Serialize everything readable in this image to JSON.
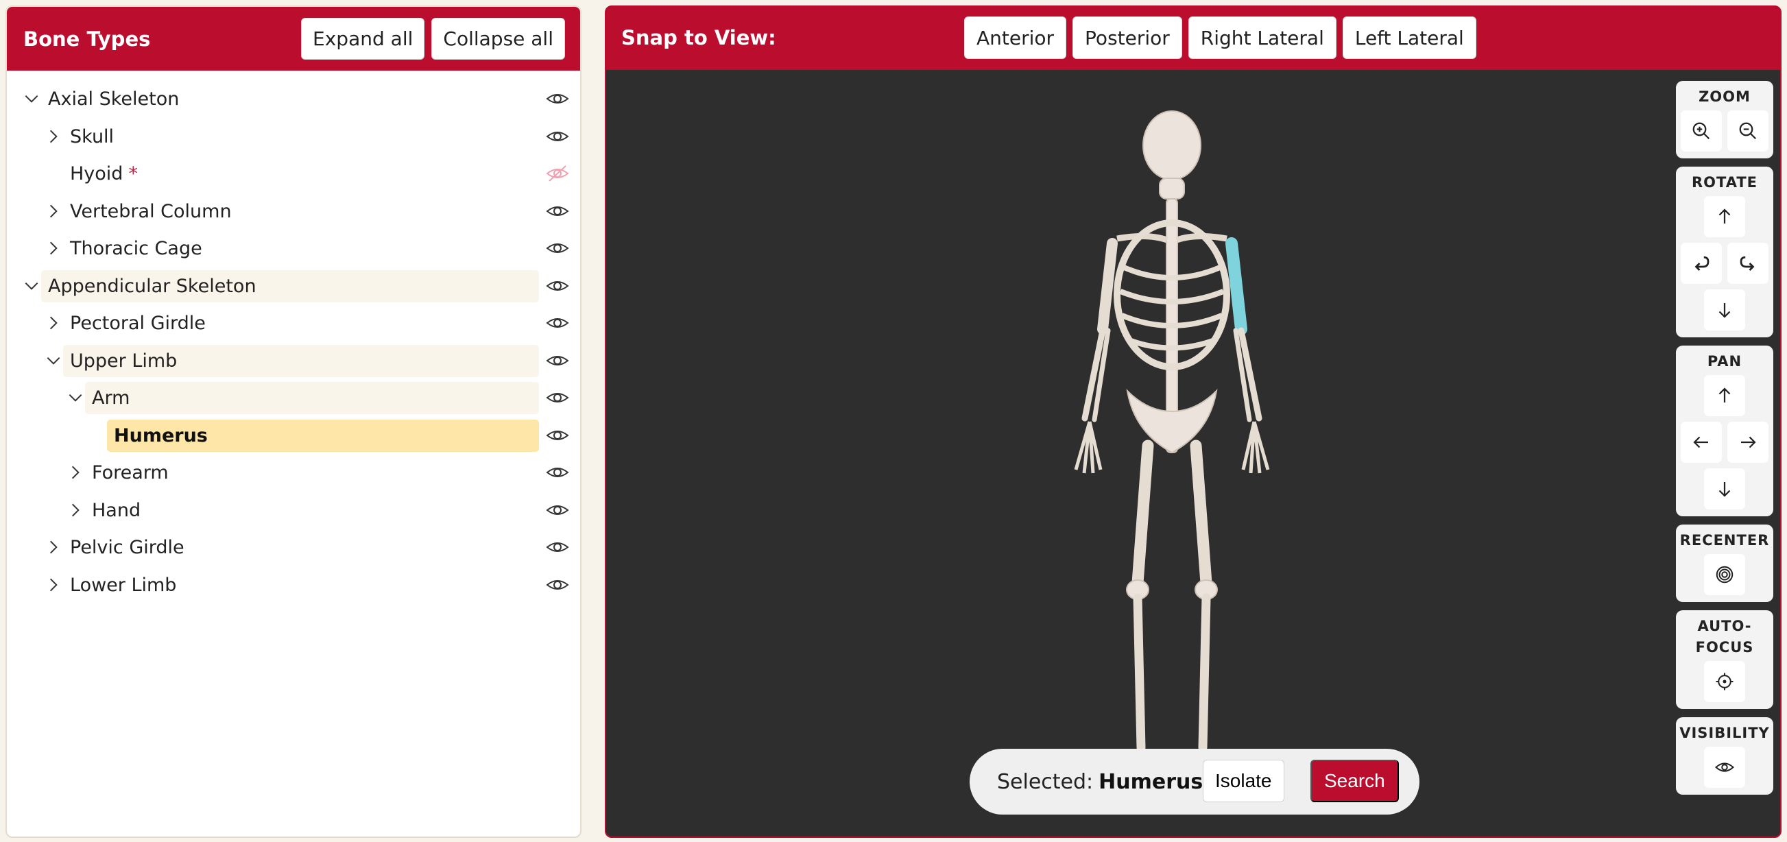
{
  "left_panel": {
    "title": "Bone Types",
    "expand_all": "Expand all",
    "collapse_all": "Collapse all",
    "tree": [
      {
        "label": "Axial Skeleton",
        "level": 0,
        "chevron": "down",
        "visible": true
      },
      {
        "label": "Skull",
        "level": 1,
        "chevron": "right",
        "visible": true
      },
      {
        "label": "Hyoid",
        "level": 1,
        "chevron": "none",
        "visible": false,
        "marker": "*"
      },
      {
        "label": "Vertebral Column",
        "level": 1,
        "chevron": "right",
        "visible": true
      },
      {
        "label": "Thoracic Cage",
        "level": 1,
        "chevron": "right",
        "visible": true
      },
      {
        "label": "Appendicular Skeleton",
        "level": 0,
        "chevron": "down",
        "visible": true,
        "highlight": "soft"
      },
      {
        "label": "Pectoral Girdle",
        "level": 1,
        "chevron": "right",
        "visible": true
      },
      {
        "label": "Upper Limb",
        "level": 1,
        "chevron": "down",
        "visible": true,
        "highlight": "soft"
      },
      {
        "label": "Arm",
        "level": 2,
        "chevron": "down",
        "visible": true,
        "highlight": "soft"
      },
      {
        "label": "Humerus",
        "level": 3,
        "chevron": "none",
        "visible": true,
        "highlight": "selected"
      },
      {
        "label": "Forearm",
        "level": 2,
        "chevron": "right",
        "visible": true
      },
      {
        "label": "Hand",
        "level": 2,
        "chevron": "right",
        "visible": true
      },
      {
        "label": "Pelvic Girdle",
        "level": 1,
        "chevron": "right",
        "visible": true
      },
      {
        "label": "Lower Limb",
        "level": 1,
        "chevron": "right",
        "visible": true
      }
    ]
  },
  "viewer": {
    "snap_label": "Snap to View:",
    "snap_buttons": [
      "Anterior",
      "Posterior",
      "Right Lateral",
      "Left Lateral"
    ],
    "controls": {
      "zoom": "ZOOM",
      "rotate": "ROTATE",
      "pan": "PAN",
      "recenter": "RECENTER",
      "autofocus_1": "AUTO-",
      "autofocus_2": "FOCUS",
      "visibility": "VISIBILITY"
    },
    "selection": {
      "prefix": "Selected:",
      "name": "Humerus",
      "isolate": "Isolate",
      "search": "Search"
    }
  },
  "colors": {
    "brand": "#bb0e2f",
    "selected_row": "#fde6a7",
    "highlight_bone": "#7fd3dc",
    "viewer_bg": "#2e2e2e",
    "hidden_eye": "#f0a0b0"
  },
  "icons": {
    "visible": "eye-icon",
    "hidden": "eye-off-icon",
    "expanded": "chevron-down-icon",
    "collapsed": "chevron-right-icon"
  }
}
